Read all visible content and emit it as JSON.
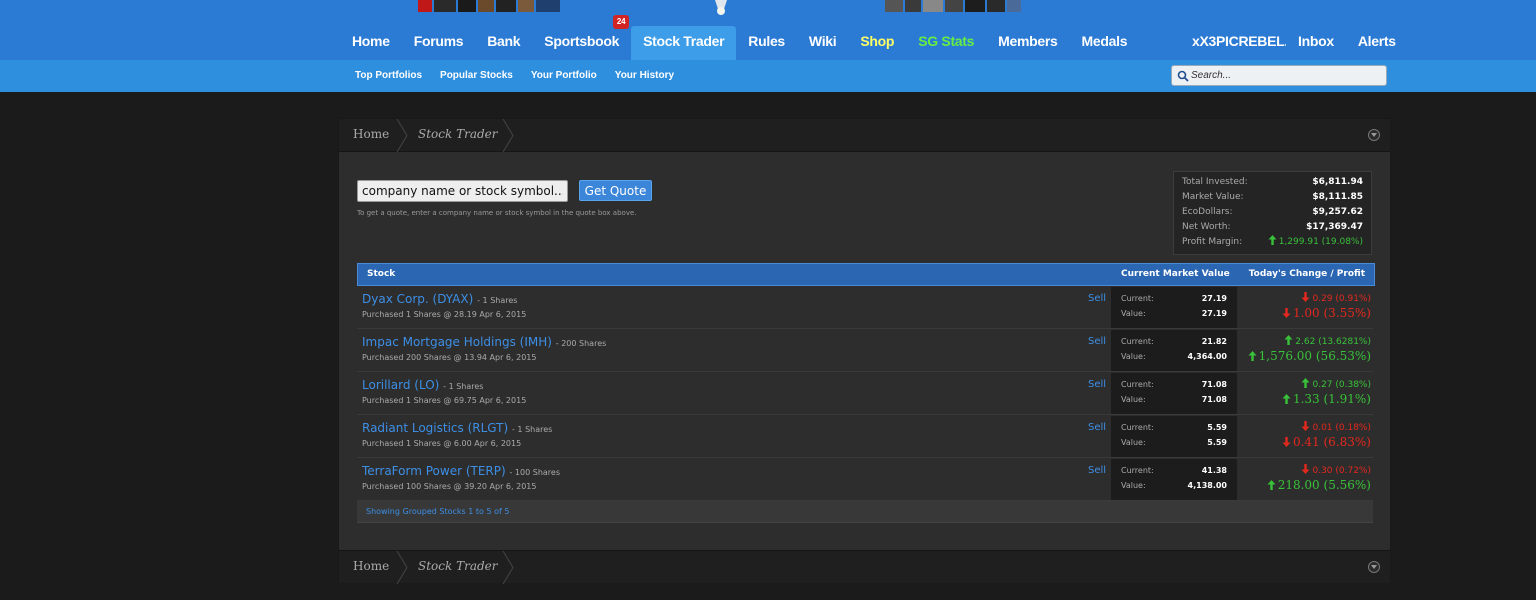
{
  "colors": {
    "header_bg": "#2b7ad4",
    "subnav_bg": "#2f8fdf",
    "active_tab": "#3d9de8",
    "link_blue": "#3d8fe6",
    "positive": "#39c239",
    "negative": "#e3281e",
    "shop": "#ffff66",
    "sg_stats": "#66ee44"
  },
  "nav": {
    "tabs": [
      {
        "label": "Home"
      },
      {
        "label": "Forums"
      },
      {
        "label": "Bank"
      },
      {
        "label": "Sportsbook",
        "badge": "24"
      },
      {
        "label": "Stock Trader",
        "active": true
      },
      {
        "label": "Rules"
      },
      {
        "label": "Wiki"
      },
      {
        "label": "Shop"
      },
      {
        "label": "SG Stats"
      },
      {
        "label": "Members"
      },
      {
        "label": "Medals"
      }
    ],
    "user": {
      "username": "xX3PICREBEL...",
      "inbox": "Inbox",
      "alerts": "Alerts"
    }
  },
  "subnav": {
    "links": [
      "Top Portfolios",
      "Popular Stocks",
      "Your Portfolio",
      "Your History"
    ],
    "search_placeholder": "Search..."
  },
  "breadcrumb": {
    "home": "Home",
    "current": "Stock Trader"
  },
  "quote": {
    "placeholder": "company name or stock symbol...",
    "button": "Get Quote",
    "hint": "To get a quote, enter a company name or stock symbol in the quote box above."
  },
  "summary": [
    {
      "label": "Total Invested:",
      "value": "$6,811.94"
    },
    {
      "label": "Market Value:",
      "value": "$8,111.85"
    },
    {
      "label": "EcoDollars:",
      "value": "$9,257.62"
    },
    {
      "label": "Net Worth:",
      "value": "$17,369.47"
    },
    {
      "label": "Profit Margin:",
      "value": "1,299.91 (19.08%)",
      "direction": "up"
    }
  ],
  "table": {
    "headers": {
      "stock": "Stock",
      "market": "Current Market Value",
      "change": "Today's Change / Profit"
    },
    "labels": {
      "current": "Current:",
      "value": "Value:",
      "sell": "Sell"
    },
    "rows": [
      {
        "name": "Dyax Corp. (DYAX)",
        "shares": "- 1 Shares",
        "purchase": "Purchased 1 Shares @ 28.19 Apr 6, 2015",
        "current": "27.19",
        "value": "27.19",
        "day_change": "0.29 (0.91%)",
        "day_dir": "down",
        "profit": "1.00 (3.55%)",
        "profit_dir": "down"
      },
      {
        "name": "Impac Mortgage Holdings (IMH)",
        "shares": "- 200 Shares",
        "purchase": "Purchased 200 Shares @ 13.94 Apr 6, 2015",
        "current": "21.82",
        "value": "4,364.00",
        "day_change": "2.62 (13.6281%)",
        "day_dir": "up",
        "profit": "1,576.00 (56.53%)",
        "profit_dir": "up"
      },
      {
        "name": "Lorillard (LO)",
        "shares": "- 1 Shares",
        "purchase": "Purchased 1 Shares @ 69.75 Apr 6, 2015",
        "current": "71.08",
        "value": "71.08",
        "day_change": "0.27 (0.38%)",
        "day_dir": "up",
        "profit": "1.33 (1.91%)",
        "profit_dir": "up"
      },
      {
        "name": "Radiant Logistics (RLGT)",
        "shares": "- 1 Shares",
        "purchase": "Purchased 1 Shares @ 6.00 Apr 6, 2015",
        "current": "5.59",
        "value": "5.59",
        "day_change": "0.01 (0.18%)",
        "day_dir": "down",
        "profit": "0.41 (6.83%)",
        "profit_dir": "down"
      },
      {
        "name": "TerraForm Power (TERP)",
        "shares": "- 100 Shares",
        "purchase": "Purchased 100 Shares @ 39.20 Apr 6, 2015",
        "current": "41.38",
        "value": "4,138.00",
        "day_change": "0.30 (0.72%)",
        "day_dir": "down",
        "profit": "218.00 (5.56%)",
        "profit_dir": "up"
      }
    ],
    "footer": "Showing Grouped Stocks 1 to 5 of 5"
  }
}
